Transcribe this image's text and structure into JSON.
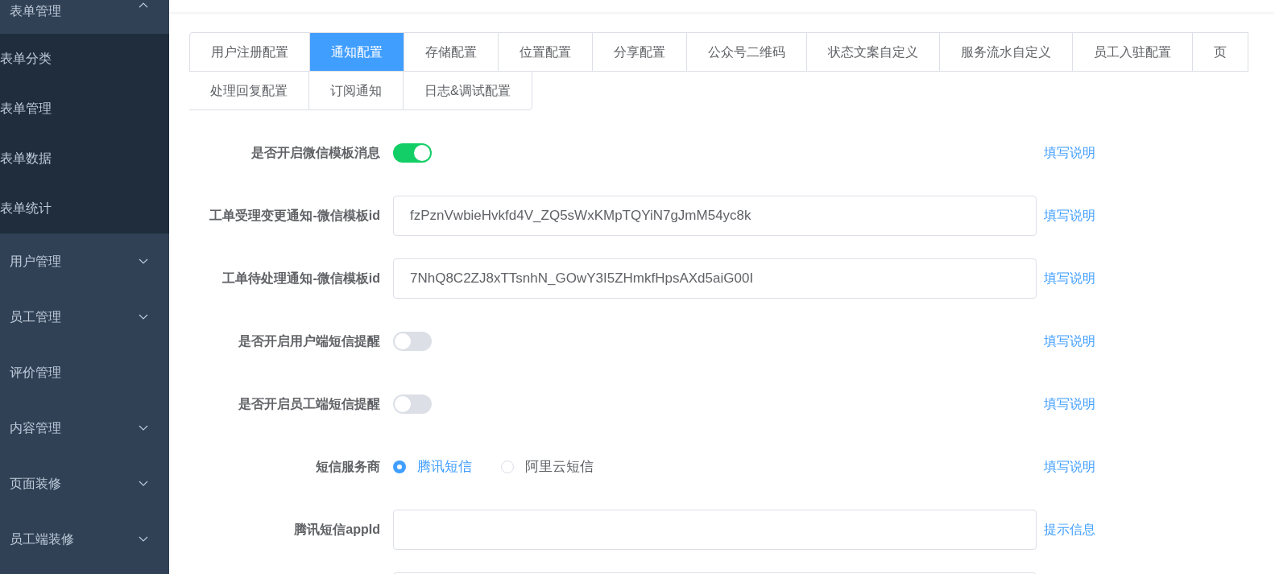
{
  "sidebar": {
    "items": [
      {
        "label": "表单管理",
        "expanded": true,
        "children": [
          {
            "label": "表单分类"
          },
          {
            "label": "表单管理"
          },
          {
            "label": "表单数据"
          },
          {
            "label": "表单统计"
          }
        ]
      },
      {
        "label": "用户管理",
        "expanded": false
      },
      {
        "label": "员工管理",
        "expanded": false
      },
      {
        "label": "评价管理"
      },
      {
        "label": "内容管理",
        "expanded": false
      },
      {
        "label": "页面装修",
        "expanded": false
      },
      {
        "label": "员工端装修",
        "expanded": false
      }
    ]
  },
  "tab_rows": [
    [
      {
        "label": "用户注册配置",
        "selected": false
      },
      {
        "label": "通知配置",
        "selected": true
      },
      {
        "label": "存储配置",
        "selected": false
      },
      {
        "label": "位置配置",
        "selected": false
      },
      {
        "label": "分享配置",
        "selected": false
      },
      {
        "label": "公众号二维码",
        "selected": false
      },
      {
        "label": "状态文案自定义",
        "selected": false
      },
      {
        "label": "服务流水自定义",
        "selected": false
      },
      {
        "label": "员工入驻配置",
        "selected": false
      },
      {
        "label": "页",
        "selected": false
      }
    ],
    [
      {
        "label": "处理回复配置",
        "selected": false
      },
      {
        "label": "订阅通知",
        "selected": false
      },
      {
        "label": "日志&调试配置",
        "selected": false
      }
    ]
  ],
  "form": [
    {
      "kind": "switch",
      "label": "是否开启微信模板消息",
      "on": true,
      "help": "填写说明"
    },
    {
      "kind": "input",
      "label": "工单受理变更通知-微信模板id",
      "value": "fzPznVwbieHvkfd4V_ZQ5sWxKMpTQYiN7gJmM54yc8k",
      "help": "填写说明"
    },
    {
      "kind": "input",
      "label": "工单待处理通知-微信模板id",
      "value": "7NhQ8C2ZJ8xTTsnhN_GOwY3I5ZHmkfHpsAXd5aiG00I",
      "help": "填写说明"
    },
    {
      "kind": "switch",
      "label": "是否开启用户端短信提醒",
      "on": false,
      "help": "填写说明"
    },
    {
      "kind": "switch",
      "label": "是否开启员工端短信提醒",
      "on": false,
      "help": "填写说明"
    },
    {
      "kind": "radio",
      "label": "短信服务商",
      "options": [
        {
          "label": "腾讯短信",
          "selected": true
        },
        {
          "label": "阿里云短信",
          "selected": false
        }
      ],
      "help": "填写说明"
    },
    {
      "kind": "input",
      "label": "腾讯短信appId",
      "help": "提示信息"
    },
    {
      "kind": "input"
    }
  ]
}
